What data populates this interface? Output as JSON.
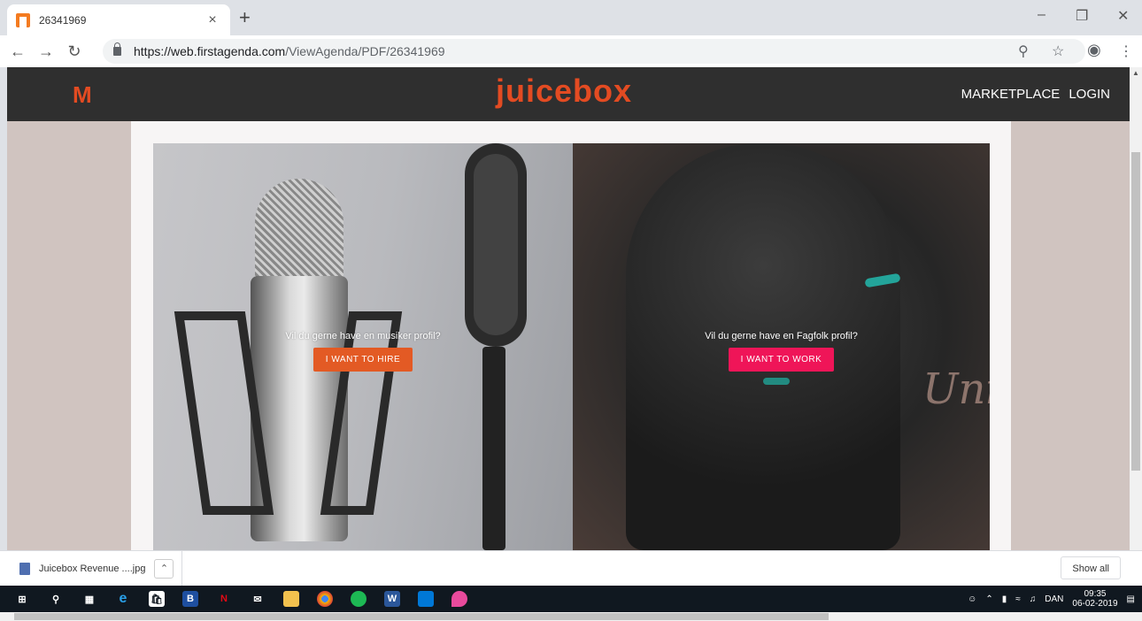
{
  "browser": {
    "tab_title": "26341969",
    "tab_close": "×",
    "new_tab": "+",
    "url_host": "https://web.firstagenda.com",
    "url_path": "/ViewAgenda/PDF/26341969"
  },
  "site": {
    "brand": "juicebox",
    "nav": {
      "marketplace": "MARKETPLACE",
      "login": "LOGIN"
    },
    "hire": {
      "prompt": "Vil du gerne have en musiker profil?",
      "button": "I WANT TO HIRE"
    },
    "work": {
      "prompt": "Vil du gerne have en Fagfolk profil?",
      "button": "I WANT TO WORK"
    }
  },
  "downloads": {
    "file_name": "Juicebox Revenue ....jpg",
    "show_all": "Show all"
  },
  "taskbar": {
    "language": "DAN",
    "time": "09:35",
    "date": "06-02-2019"
  },
  "colors": {
    "brand": "#e34b22",
    "hire_button": "#e35a24",
    "work_button": "#ef1558",
    "nav_bg": "#2f2f2f"
  }
}
